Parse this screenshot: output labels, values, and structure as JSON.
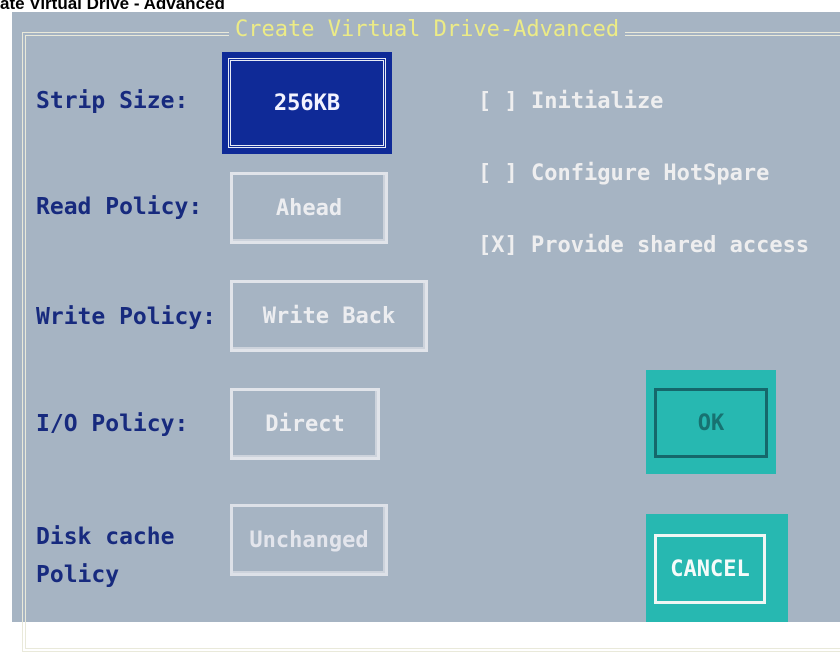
{
  "caption": "ate Virtual Drive - Advanced",
  "dialog": {
    "title": "Create Virtual Drive-Advanced"
  },
  "fields": {
    "strip_size": {
      "label": "Strip Size:",
      "value": "256KB"
    },
    "read_policy": {
      "label": "Read Policy:",
      "value": "Ahead"
    },
    "write_policy": {
      "label": "Write Policy:",
      "value": "Write Back"
    },
    "io_policy": {
      "label": "I/O Policy:",
      "value": "Direct"
    },
    "disk_cache": {
      "label_line1": "Disk cache",
      "label_line2": "Policy",
      "value": "Unchanged"
    }
  },
  "options": {
    "initialize": "[ ] Initialize",
    "configure_hotspare": "[ ] Configure HotSpare",
    "shared_access": "[X] Provide shared access"
  },
  "buttons": {
    "ok": "OK",
    "cancel": "CANCEL"
  },
  "colors": {
    "background": "#a6b4c3",
    "label_text": "#172a7e",
    "title_text": "#eceb86",
    "selected_field": "#0f2a97",
    "button_cyan": "#27b8b1"
  }
}
